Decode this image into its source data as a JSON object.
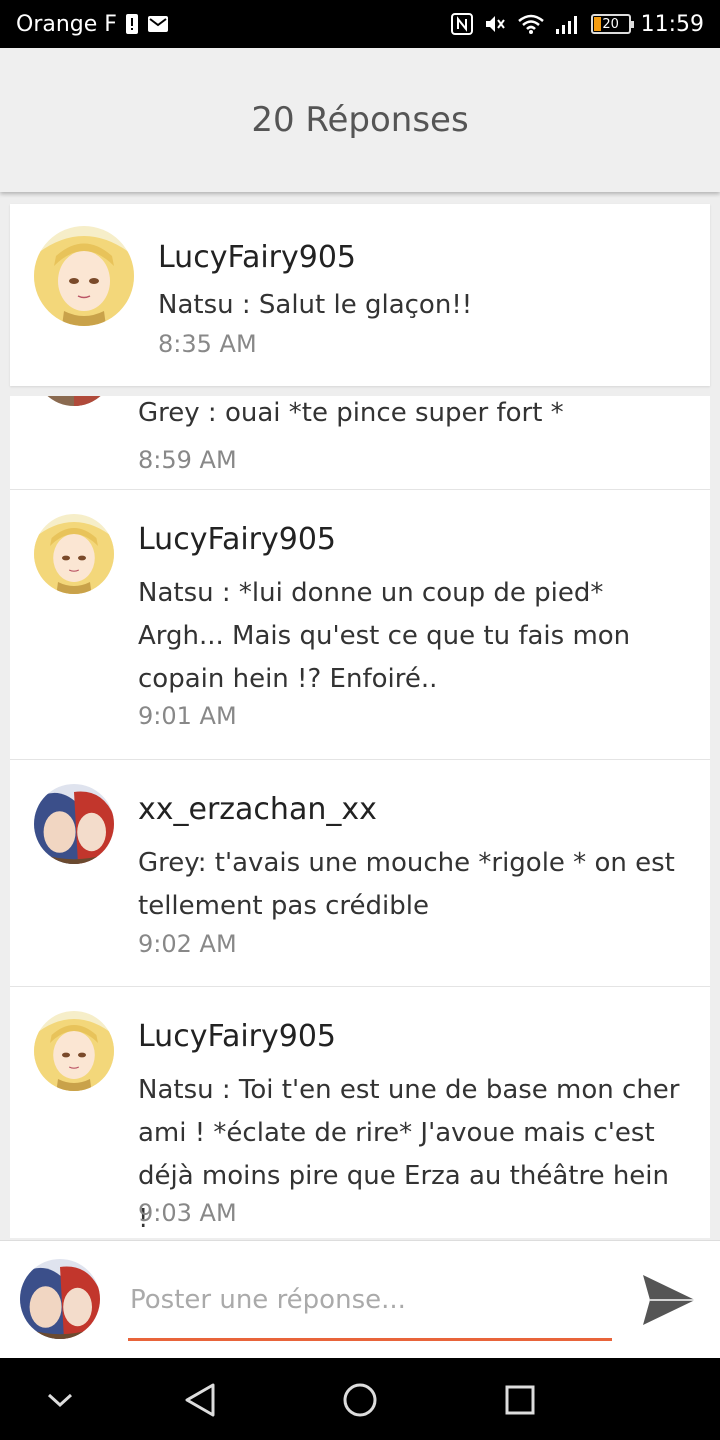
{
  "status_bar": {
    "carrier": "Orange F",
    "time": "11:59",
    "battery_level": "20",
    "icons": [
      "sim-alert-icon",
      "mail-icon",
      "nfc-icon",
      "mute-icon",
      "wifi-icon",
      "signal-icon",
      "battery-icon"
    ]
  },
  "header": {
    "title": "20 Réponses"
  },
  "original_post": {
    "author": "LucyFairy905",
    "message": "Natsu : Salut le glaçon!!",
    "time": "8:35 AM",
    "avatar": "blonde-character-avatar"
  },
  "replies": [
    {
      "author": "",
      "message": "Grey : ouai *te pince super fort *",
      "time": "8:59 AM",
      "avatar": "grey-erza-avatar"
    },
    {
      "author": "LucyFairy905",
      "message": "Natsu : *lui donne un coup de pied* Argh... Mais qu'est ce que tu fais mon copain hein !? Enfoiré..",
      "time": "9:01 AM",
      "avatar": "blonde-character-avatar"
    },
    {
      "author": "xx_erzachan_xx",
      "message": "Grey: t'avais une mouche *rigole * on est tellement pas crédible",
      "time": "9:02 AM",
      "avatar": "grey-erza-avatar"
    },
    {
      "author": "LucyFairy905",
      "message": "Natsu : Toi t'en est une de base mon cher ami ! *éclate de rire* J'avoue mais c'est déjà moins pire que Erza au théâtre hein !",
      "time": "9:03 AM",
      "avatar": "blonde-character-avatar"
    }
  ],
  "composer": {
    "placeholder": "Poster une réponse...",
    "value": "",
    "send_icon": "send-icon",
    "accent": "#e8643a"
  },
  "nav_bar": {
    "icons": [
      "collapse-chevron-icon",
      "back-icon",
      "home-icon",
      "recents-icon"
    ]
  }
}
